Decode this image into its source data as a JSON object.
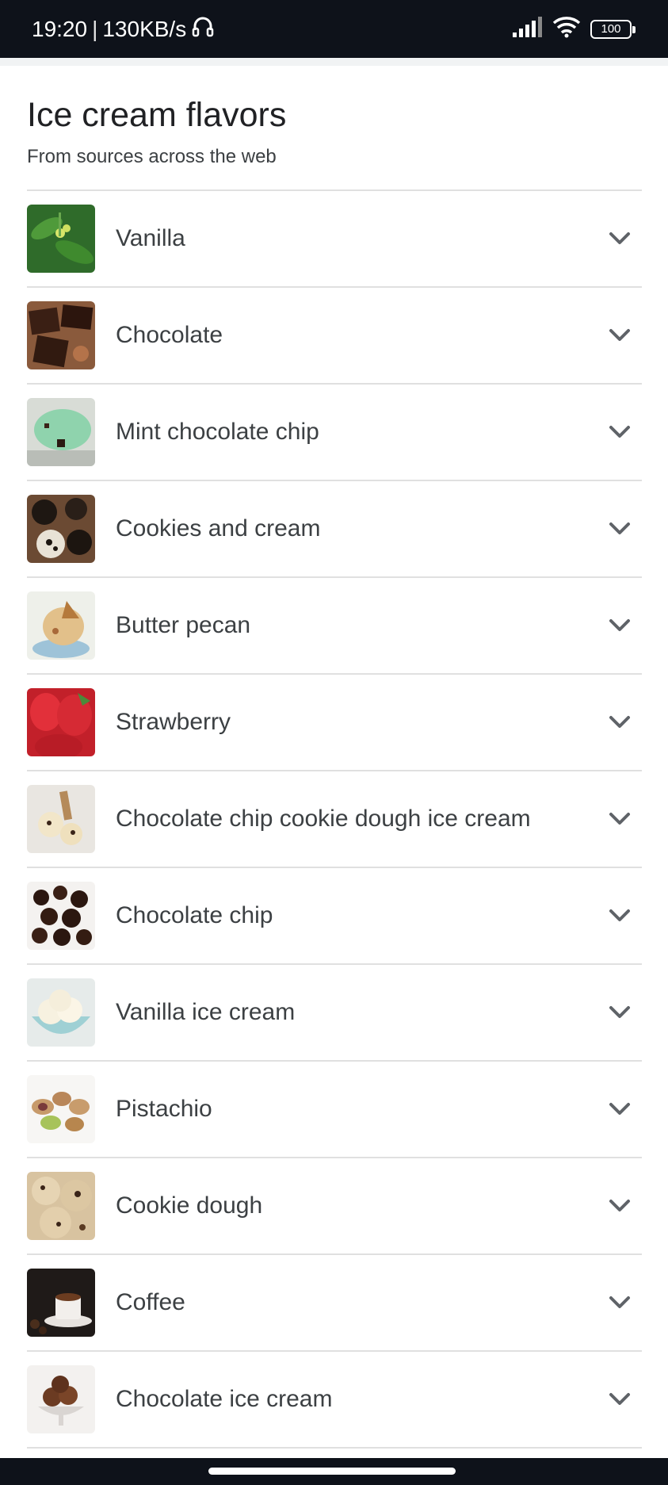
{
  "status_bar": {
    "time": "19:20",
    "separator": "|",
    "network_speed": "130KB/s",
    "battery": "100",
    "icons": [
      "headset-icon",
      "signal-icon",
      "wifi-icon",
      "battery-icon"
    ]
  },
  "header": {
    "title": "Ice cream flavors",
    "subtitle": "From sources across the web"
  },
  "flavors": [
    {
      "label": "Vanilla",
      "thumb": "vanilla-thumbnail"
    },
    {
      "label": "Chocolate",
      "thumb": "chocolate-thumbnail"
    },
    {
      "label": "Mint chocolate chip",
      "thumb": "mint-chocolate-chip-thumbnail"
    },
    {
      "label": "Cookies and cream",
      "thumb": "cookies-and-cream-thumbnail"
    },
    {
      "label": "Butter pecan",
      "thumb": "butter-pecan-thumbnail"
    },
    {
      "label": "Strawberry",
      "thumb": "strawberry-thumbnail"
    },
    {
      "label": "Chocolate chip cookie dough ice cream",
      "thumb": "cookie-dough-ice-cream-thumbnail"
    },
    {
      "label": "Chocolate chip",
      "thumb": "chocolate-chip-thumbnail"
    },
    {
      "label": "Vanilla ice cream",
      "thumb": "vanilla-ice-cream-thumbnail"
    },
    {
      "label": "Pistachio",
      "thumb": "pistachio-thumbnail"
    },
    {
      "label": "Cookie dough",
      "thumb": "cookie-dough-thumbnail"
    },
    {
      "label": "Coffee",
      "thumb": "coffee-thumbnail"
    },
    {
      "label": "Chocolate ice cream",
      "thumb": "chocolate-ice-cream-thumbnail"
    }
  ],
  "colors": {
    "status_bar_bg": "#0e121a",
    "divider": "#e0e0e0",
    "label_text": "#3c4043",
    "chevron": "#5f6368"
  }
}
